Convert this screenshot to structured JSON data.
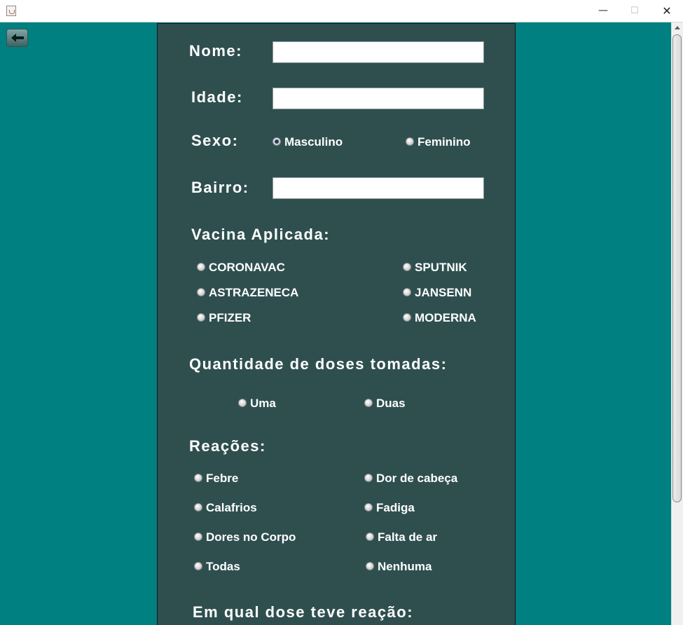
{
  "window": {
    "icon": "java-cup-icon",
    "controls": {
      "minimize": "—",
      "maximize": "☐",
      "close": "✕"
    }
  },
  "toolbar": {
    "back_icon": "arrow-left-icon"
  },
  "form": {
    "nome_label": "Nome:",
    "nome_value": "",
    "idade_label": "Idade:",
    "idade_value": "",
    "sexo_label": "Sexo:",
    "sexo_options": [
      {
        "label": "Masculino",
        "checked": true
      },
      {
        "label": "Feminino",
        "checked": false
      }
    ],
    "bairro_label": "Bairro:",
    "bairro_value": "",
    "vacina_label": "Vacina Aplicada:",
    "vacina_options": [
      {
        "label": "CORONAVAC",
        "checked": false
      },
      {
        "label": "SPUTNIK",
        "checked": false
      },
      {
        "label": "ASTRAZENECA",
        "checked": false
      },
      {
        "label": "JANSENN",
        "checked": false
      },
      {
        "label": "PFIZER",
        "checked": false
      },
      {
        "label": "MODERNA",
        "checked": false
      }
    ],
    "doses_label": "Quantidade de doses tomadas:",
    "doses_options": [
      {
        "label": "Uma",
        "checked": false
      },
      {
        "label": "Duas",
        "checked": false
      }
    ],
    "reacoes_label": "Reações:",
    "reacoes_options": [
      {
        "label": "Febre",
        "checked": false
      },
      {
        "label": "Dor de cabeça",
        "checked": false
      },
      {
        "label": "Calafrios",
        "checked": false
      },
      {
        "label": "Fadiga",
        "checked": false
      },
      {
        "label": "Dores no Corpo",
        "checked": false
      },
      {
        "label": "Falta de ar",
        "checked": false
      },
      {
        "label": "Todas",
        "checked": false
      },
      {
        "label": "Nenhuma",
        "checked": false
      }
    ],
    "dose_reacao_label": "Em qual dose teve reação:"
  },
  "colors": {
    "background": "#008080",
    "panel": "#2f4f4f",
    "text": "#ffffff"
  }
}
